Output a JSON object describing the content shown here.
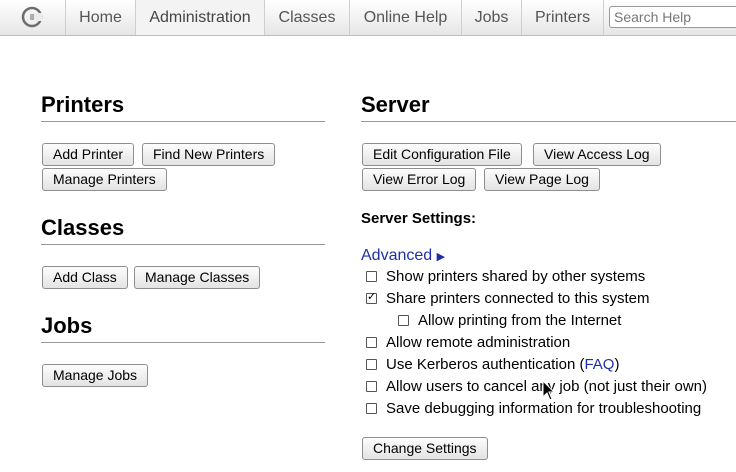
{
  "nav": {
    "tabs": [
      {
        "label": "Home",
        "active": false
      },
      {
        "label": "Administration",
        "active": true
      },
      {
        "label": "Classes",
        "active": false
      },
      {
        "label": "Online Help",
        "active": false
      },
      {
        "label": "Jobs",
        "active": false
      },
      {
        "label": "Printers",
        "active": false
      }
    ],
    "search_placeholder": "Search Help"
  },
  "printers": {
    "heading": "Printers",
    "buttons": {
      "add": "Add Printer",
      "find_new": "Find New Printers",
      "manage": "Manage Printers"
    }
  },
  "classes": {
    "heading": "Classes",
    "buttons": {
      "add": "Add Class",
      "manage": "Manage Classes"
    }
  },
  "jobs": {
    "heading": "Jobs",
    "buttons": {
      "manage": "Manage Jobs"
    }
  },
  "server": {
    "heading": "Server",
    "buttons": {
      "edit_config": "Edit Configuration File",
      "view_access_log": "View Access Log",
      "view_error_log": "View Error Log",
      "view_page_log": "View Page Log"
    },
    "settings_label": "Server Settings:",
    "advanced_label": "Advanced",
    "advanced_arrow": "▶",
    "options": {
      "show_shared": {
        "label": "Show printers shared by other systems",
        "checked": false
      },
      "share_connected": {
        "label": "Share printers connected to this system",
        "checked": true
      },
      "allow_internet": {
        "label": "Allow printing from the Internet",
        "checked": false
      },
      "remote_admin": {
        "label": "Allow remote administration",
        "checked": false
      },
      "kerberos": {
        "label": "Use Kerberos authentication (",
        "link": "FAQ",
        "suffix": ")",
        "checked": false
      },
      "cancel_any": {
        "label": "Allow users to cancel any job (not just their own)",
        "checked": false
      },
      "debug_info": {
        "label": "Save debugging information for troubleshooting",
        "checked": false
      }
    },
    "change_settings": "Change Settings"
  },
  "icons": {
    "logo": "cups-logo-icon",
    "cursor": "mouse-pointer-icon"
  }
}
